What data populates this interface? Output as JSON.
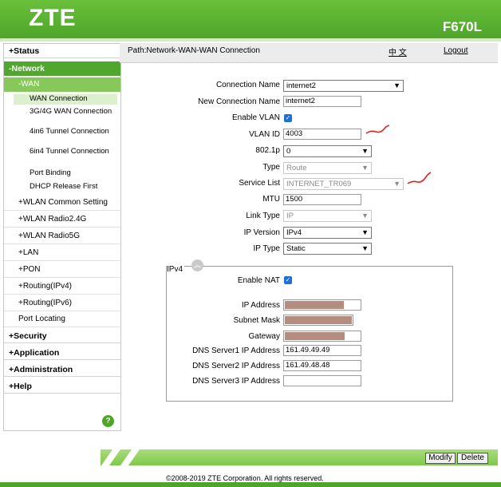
{
  "header": {
    "logo": "ZTE",
    "model": "F670L"
  },
  "colors": {
    "brand_green": "#4ea52a",
    "menu_active": "#86c95a",
    "redaction": "#b58d80",
    "annotation": "#e02020"
  },
  "top_bar": {
    "path": "Path:Network-WAN-WAN Connection",
    "language": "中 文",
    "logout": "Logout"
  },
  "sidebar": {
    "status": "+Status",
    "network": "-Network",
    "wan": "-WAN",
    "wan_items": [
      "WAN Connection",
      "3G/4G WAN Connection",
      "4in6 Tunnel Connection",
      "6in4 Tunnel Connection",
      "Port Binding",
      "DHCP Release First"
    ],
    "sub_items": [
      "+WLAN Common Setting",
      "+WLAN Radio2.4G",
      "+WLAN Radio5G",
      "+LAN",
      "+PON",
      "+Routing(IPv4)",
      "+Routing(IPv6)",
      "Port Locating"
    ],
    "bottom_items": [
      "+Security",
      "+Application",
      "+Administration",
      "+Help"
    ],
    "help_icon": "?"
  },
  "form": {
    "connection_name": {
      "label": "Connection Name",
      "value": "internet2"
    },
    "new_connection_name": {
      "label": "New Connection Name",
      "value": "internet2"
    },
    "enable_vlan": {
      "label": "Enable VLAN",
      "checked": true
    },
    "vlan_id": {
      "label": "VLAN ID",
      "value": "4003"
    },
    "p8021": {
      "label": "802.1p",
      "value": "0"
    },
    "type": {
      "label": "Type",
      "value": "Route"
    },
    "service_list": {
      "label": "Service List",
      "value": "INTERNET_TR069"
    },
    "mtu": {
      "label": "MTU",
      "value": "1500"
    },
    "link_type": {
      "label": "Link Type",
      "value": "IP"
    },
    "ip_version": {
      "label": "IP Version",
      "value": "IPv4"
    },
    "ip_type": {
      "label": "IP Type",
      "value": "Static"
    }
  },
  "ipv4": {
    "legend": "IPv4",
    "enable_nat": {
      "label": "Enable NAT",
      "checked": true
    },
    "ip_address": {
      "label": "IP Address"
    },
    "subnet_mask": {
      "label": "Subnet Mask"
    },
    "gateway": {
      "label": "Gateway"
    },
    "dns1": {
      "label": "DNS Server1 IP Address",
      "value": "161.49.49.49"
    },
    "dns2": {
      "label": "DNS Server2 IP Address",
      "value": "161.49.48.48"
    },
    "dns3": {
      "label": "DNS Server3 IP Address",
      "value": ""
    }
  },
  "buttons": {
    "modify": "Modify",
    "delete": "Delete"
  },
  "footer": {
    "copyright": "©2008-2019 ZTE Corporation. All rights reserved."
  }
}
